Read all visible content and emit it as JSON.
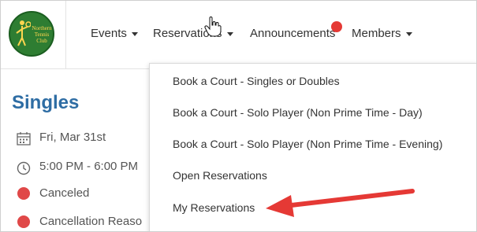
{
  "logo": {
    "text": "Northern Tennis Club"
  },
  "nav": {
    "events": "Events",
    "reservations": "Reservations",
    "announcements": "Announcements",
    "members": "Members"
  },
  "page": {
    "title": "Singles",
    "date": "Fri, Mar 31st",
    "time": "5:00 PM - 6:00 PM",
    "status": "Canceled",
    "cancellation_reason": "Cancellation Reaso"
  },
  "dropdown": {
    "items": [
      "Book a Court - Singles or Doubles",
      "Book a Court - Solo Player (Non Prime Time - Day)",
      "Book a Court - Solo Player (Non Prime Time - Evening)",
      "Open Reservations",
      "My Reservations"
    ]
  },
  "colors": {
    "accent": "#2e6da4",
    "status_red": "#e04848",
    "annotation_arrow": "#e53935",
    "logo_green": "#2e7d32"
  },
  "icons": [
    "calendar-icon",
    "clock-icon",
    "hand-cursor-icon",
    "caret-down-icon"
  ]
}
